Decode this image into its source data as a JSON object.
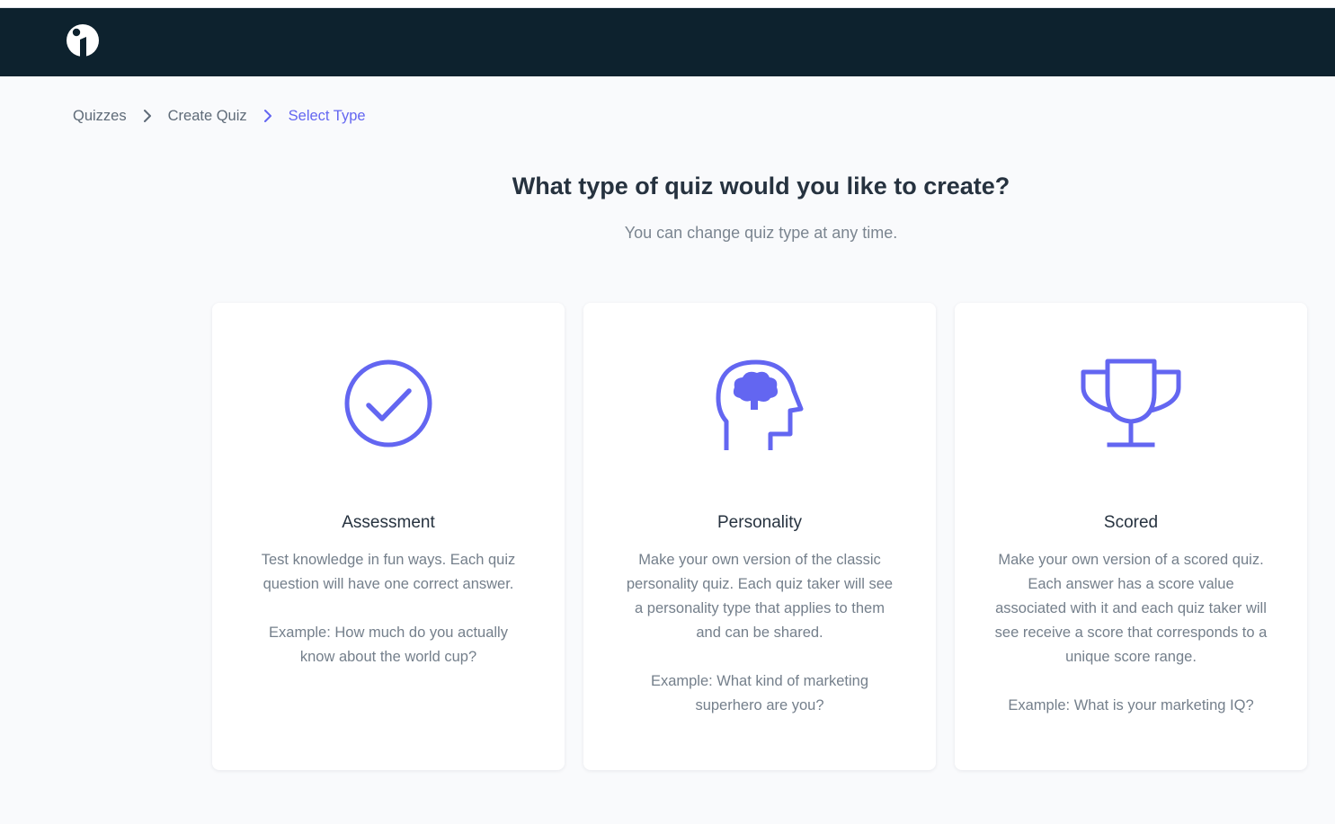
{
  "breadcrumb": {
    "items": [
      {
        "label": "Quizzes"
      },
      {
        "label": "Create Quiz"
      },
      {
        "label": "Select Type"
      }
    ]
  },
  "header": {
    "title": "What type of quiz would you like to create?",
    "subtitle": "You can change quiz type at any time."
  },
  "cards": [
    {
      "icon": "checkmark-circle-icon",
      "title": "Assessment",
      "description": "Test knowledge in fun ways. Each quiz question will have one correct answer.",
      "example": "Example: How much do you actually know about the world cup?"
    },
    {
      "icon": "brain-head-icon",
      "title": "Personality",
      "description": "Make your own version of the classic personality quiz. Each quiz taker will see a personality type that applies to them and can be shared.",
      "example": "Example: What kind of marketing superhero are you?"
    },
    {
      "icon": "trophy-icon",
      "title": "Scored",
      "description": "Make your own version of a scored quiz. Each answer has a score value associated with it and each quiz taker will see receive a score that corresponds to a unique score range.",
      "example": "Example: What is your marketing IQ?"
    }
  ],
  "colors": {
    "navbar": "#0d222e",
    "accent": "#6366f1",
    "background": "#f9fafc"
  }
}
